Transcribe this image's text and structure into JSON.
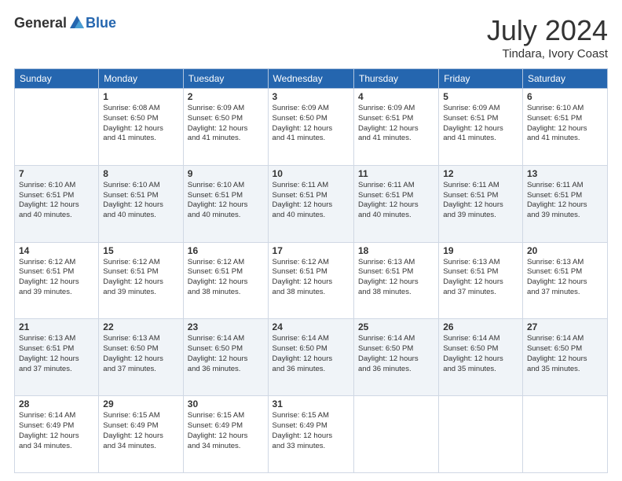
{
  "header": {
    "logo_general": "General",
    "logo_blue": "Blue",
    "month_title": "July 2024",
    "location": "Tindara, Ivory Coast"
  },
  "days_of_week": [
    "Sunday",
    "Monday",
    "Tuesday",
    "Wednesday",
    "Thursday",
    "Friday",
    "Saturday"
  ],
  "weeks": [
    [
      {
        "day": "",
        "info": ""
      },
      {
        "day": "1",
        "info": "Sunrise: 6:08 AM\nSunset: 6:50 PM\nDaylight: 12 hours\nand 41 minutes."
      },
      {
        "day": "2",
        "info": "Sunrise: 6:09 AM\nSunset: 6:50 PM\nDaylight: 12 hours\nand 41 minutes."
      },
      {
        "day": "3",
        "info": "Sunrise: 6:09 AM\nSunset: 6:50 PM\nDaylight: 12 hours\nand 41 minutes."
      },
      {
        "day": "4",
        "info": "Sunrise: 6:09 AM\nSunset: 6:51 PM\nDaylight: 12 hours\nand 41 minutes."
      },
      {
        "day": "5",
        "info": "Sunrise: 6:09 AM\nSunset: 6:51 PM\nDaylight: 12 hours\nand 41 minutes."
      },
      {
        "day": "6",
        "info": "Sunrise: 6:10 AM\nSunset: 6:51 PM\nDaylight: 12 hours\nand 41 minutes."
      }
    ],
    [
      {
        "day": "7",
        "info": "Sunrise: 6:10 AM\nSunset: 6:51 PM\nDaylight: 12 hours\nand 40 minutes."
      },
      {
        "day": "8",
        "info": "Sunrise: 6:10 AM\nSunset: 6:51 PM\nDaylight: 12 hours\nand 40 minutes."
      },
      {
        "day": "9",
        "info": "Sunrise: 6:10 AM\nSunset: 6:51 PM\nDaylight: 12 hours\nand 40 minutes."
      },
      {
        "day": "10",
        "info": "Sunrise: 6:11 AM\nSunset: 6:51 PM\nDaylight: 12 hours\nand 40 minutes."
      },
      {
        "day": "11",
        "info": "Sunrise: 6:11 AM\nSunset: 6:51 PM\nDaylight: 12 hours\nand 40 minutes."
      },
      {
        "day": "12",
        "info": "Sunrise: 6:11 AM\nSunset: 6:51 PM\nDaylight: 12 hours\nand 39 minutes."
      },
      {
        "day": "13",
        "info": "Sunrise: 6:11 AM\nSunset: 6:51 PM\nDaylight: 12 hours\nand 39 minutes."
      }
    ],
    [
      {
        "day": "14",
        "info": "Sunrise: 6:12 AM\nSunset: 6:51 PM\nDaylight: 12 hours\nand 39 minutes."
      },
      {
        "day": "15",
        "info": "Sunrise: 6:12 AM\nSunset: 6:51 PM\nDaylight: 12 hours\nand 39 minutes."
      },
      {
        "day": "16",
        "info": "Sunrise: 6:12 AM\nSunset: 6:51 PM\nDaylight: 12 hours\nand 38 minutes."
      },
      {
        "day": "17",
        "info": "Sunrise: 6:12 AM\nSunset: 6:51 PM\nDaylight: 12 hours\nand 38 minutes."
      },
      {
        "day": "18",
        "info": "Sunrise: 6:13 AM\nSunset: 6:51 PM\nDaylight: 12 hours\nand 38 minutes."
      },
      {
        "day": "19",
        "info": "Sunrise: 6:13 AM\nSunset: 6:51 PM\nDaylight: 12 hours\nand 37 minutes."
      },
      {
        "day": "20",
        "info": "Sunrise: 6:13 AM\nSunset: 6:51 PM\nDaylight: 12 hours\nand 37 minutes."
      }
    ],
    [
      {
        "day": "21",
        "info": "Sunrise: 6:13 AM\nSunset: 6:51 PM\nDaylight: 12 hours\nand 37 minutes."
      },
      {
        "day": "22",
        "info": "Sunrise: 6:13 AM\nSunset: 6:50 PM\nDaylight: 12 hours\nand 37 minutes."
      },
      {
        "day": "23",
        "info": "Sunrise: 6:14 AM\nSunset: 6:50 PM\nDaylight: 12 hours\nand 36 minutes."
      },
      {
        "day": "24",
        "info": "Sunrise: 6:14 AM\nSunset: 6:50 PM\nDaylight: 12 hours\nand 36 minutes."
      },
      {
        "day": "25",
        "info": "Sunrise: 6:14 AM\nSunset: 6:50 PM\nDaylight: 12 hours\nand 36 minutes."
      },
      {
        "day": "26",
        "info": "Sunrise: 6:14 AM\nSunset: 6:50 PM\nDaylight: 12 hours\nand 35 minutes."
      },
      {
        "day": "27",
        "info": "Sunrise: 6:14 AM\nSunset: 6:50 PM\nDaylight: 12 hours\nand 35 minutes."
      }
    ],
    [
      {
        "day": "28",
        "info": "Sunrise: 6:14 AM\nSunset: 6:49 PM\nDaylight: 12 hours\nand 34 minutes."
      },
      {
        "day": "29",
        "info": "Sunrise: 6:15 AM\nSunset: 6:49 PM\nDaylight: 12 hours\nand 34 minutes."
      },
      {
        "day": "30",
        "info": "Sunrise: 6:15 AM\nSunset: 6:49 PM\nDaylight: 12 hours\nand 34 minutes."
      },
      {
        "day": "31",
        "info": "Sunrise: 6:15 AM\nSunset: 6:49 PM\nDaylight: 12 hours\nand 33 minutes."
      },
      {
        "day": "",
        "info": ""
      },
      {
        "day": "",
        "info": ""
      },
      {
        "day": "",
        "info": ""
      }
    ]
  ]
}
